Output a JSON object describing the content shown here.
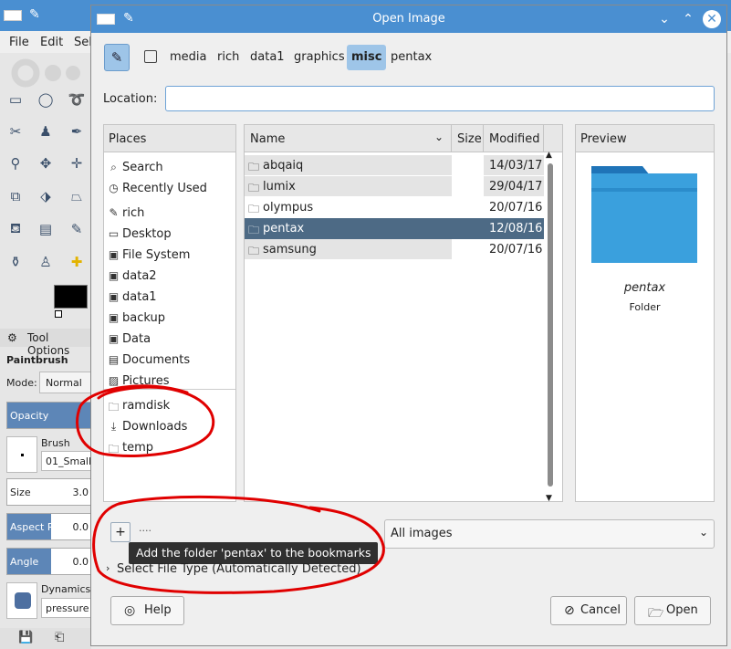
{
  "bg_app": {
    "menu": [
      "File",
      "Edit",
      "Sel"
    ],
    "tool_options_title": "Tool Options",
    "tool_name": "Paintbrush",
    "mode_label": "Mode:",
    "mode_value": "Normal",
    "opacity_label": "Opacity",
    "brush_label": "Brush",
    "brush_value": "01_Small",
    "size_label": "Size",
    "size_value": "3.0",
    "aspect_label": "Aspect R...",
    "aspect_value": "0.0",
    "angle_label": "Angle",
    "angle_value": "0.0",
    "dynamics_label": "Dynamics",
    "dynamics_value": "pressure"
  },
  "dialog": {
    "title": "Open Image",
    "path": [
      "media",
      "rich",
      "data1",
      "graphics",
      "misc",
      "pentax"
    ],
    "active_crumb": "misc",
    "location_label": "Location:",
    "location_value": "",
    "places_header": "Places",
    "places": [
      {
        "label": "Search",
        "icon": "search-icon"
      },
      {
        "label": "Recently Used",
        "icon": "clock-icon"
      },
      {
        "label": "rich",
        "icon": "pencil-icon"
      },
      {
        "label": "Desktop",
        "icon": "desktop-icon"
      },
      {
        "label": "File System",
        "icon": "drive-icon"
      },
      {
        "label": "data2",
        "icon": "drive-icon"
      },
      {
        "label": "data1",
        "icon": "drive-icon"
      },
      {
        "label": "backup",
        "icon": "drive-icon"
      },
      {
        "label": "Data",
        "icon": "drive-icon"
      },
      {
        "label": "Documents",
        "icon": "document-icon"
      },
      {
        "label": "Pictures",
        "icon": "picture-icon"
      },
      {
        "label": "ramdisk",
        "icon": "folder-icon"
      },
      {
        "label": "Downloads",
        "icon": "download-icon"
      },
      {
        "label": "temp",
        "icon": "folder-icon"
      }
    ],
    "columns": {
      "name": "Name",
      "size": "Size",
      "modified": "Modified"
    },
    "files": [
      {
        "name": "abqaiq",
        "modified": "14/03/17"
      },
      {
        "name": "lumix",
        "modified": "29/04/17"
      },
      {
        "name": "olympus",
        "modified": "20/07/16"
      },
      {
        "name": "pentax",
        "modified": "12/08/16"
      },
      {
        "name": "samsung",
        "modified": "20/07/16"
      }
    ],
    "selected_file": "pentax",
    "preview_header": "Preview",
    "preview_name": "pentax",
    "preview_kind": "Folder",
    "remove_bookmark_label": "....",
    "tooltip": "Add the folder 'pentax' to the bookmarks",
    "filter_value": "All images",
    "filetype_label": "Select File Type (Automatically Detected)",
    "help_label": "Help",
    "cancel_label": "Cancel",
    "open_label": "Open"
  },
  "colors": {
    "titlebar": "#4a8fd1",
    "selection": "#4d6a85",
    "folder": "#3aa0dd",
    "annotation": "#e00000"
  }
}
